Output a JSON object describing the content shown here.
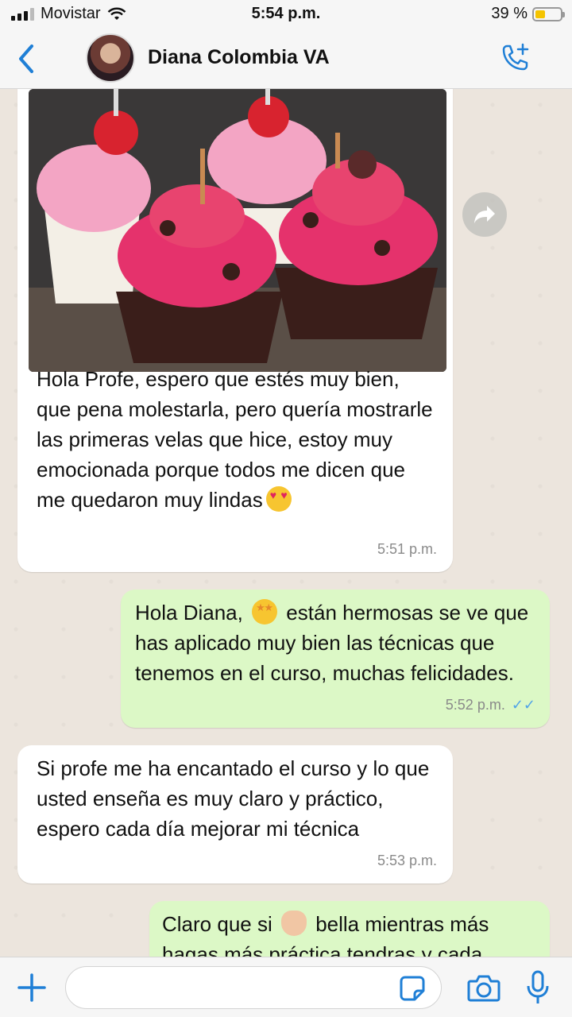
{
  "status_bar": {
    "carrier": "Movistar",
    "time": "5:54 p.m.",
    "battery_text": "39 %",
    "battery_level": 0.39
  },
  "header": {
    "contact_name": "Diana Colombia VA",
    "icons": [
      "back-chevron-icon",
      "avatar",
      "add-call-icon"
    ]
  },
  "messages": [
    {
      "direction": "incoming",
      "has_photo": true,
      "text": "Hola Profe, espero que estés muy bien, que pena molestarla, pero quería mostrarle las primeras velas que hice, estoy muy emocionada porque todos me dicen que me quedaron muy lindas",
      "emoji": "heart-eyes",
      "time": "5:51 p.m."
    },
    {
      "direction": "outgoing",
      "text_before_emoji": "Hola Diana, ",
      "emoji": "star-struck",
      "text_after_emoji": " están hermosas se ve que has aplicado muy bien las técnicas que tenemos en el curso, muchas felicidades.",
      "time": "5:52 p.m.",
      "read_ticks": "✓✓"
    },
    {
      "direction": "incoming",
      "text": "Si profe me ha encantado el curso y lo que usted enseña es muy claro y práctico, espero cada día mejorar mi técnica",
      "time": "5:53 p.m."
    },
    {
      "direction": "outgoing",
      "text_before_emoji": "Claro que si ",
      "emoji": "clapping-hands",
      "text_after_emoji": " bella mientras más hagas más práctica tendras y cada"
    }
  ],
  "colors": {
    "accent": "#1f7fd6",
    "incoming_bubble": "#ffffff",
    "outgoing_bubble": "#dcf8c6",
    "chat_background": "#ece5dd",
    "read_ticks": "#4fa3e8"
  },
  "input_bar": {
    "placeholder": "",
    "icons": [
      "plus-icon",
      "sticker-icon",
      "camera-icon",
      "microphone-icon"
    ]
  }
}
